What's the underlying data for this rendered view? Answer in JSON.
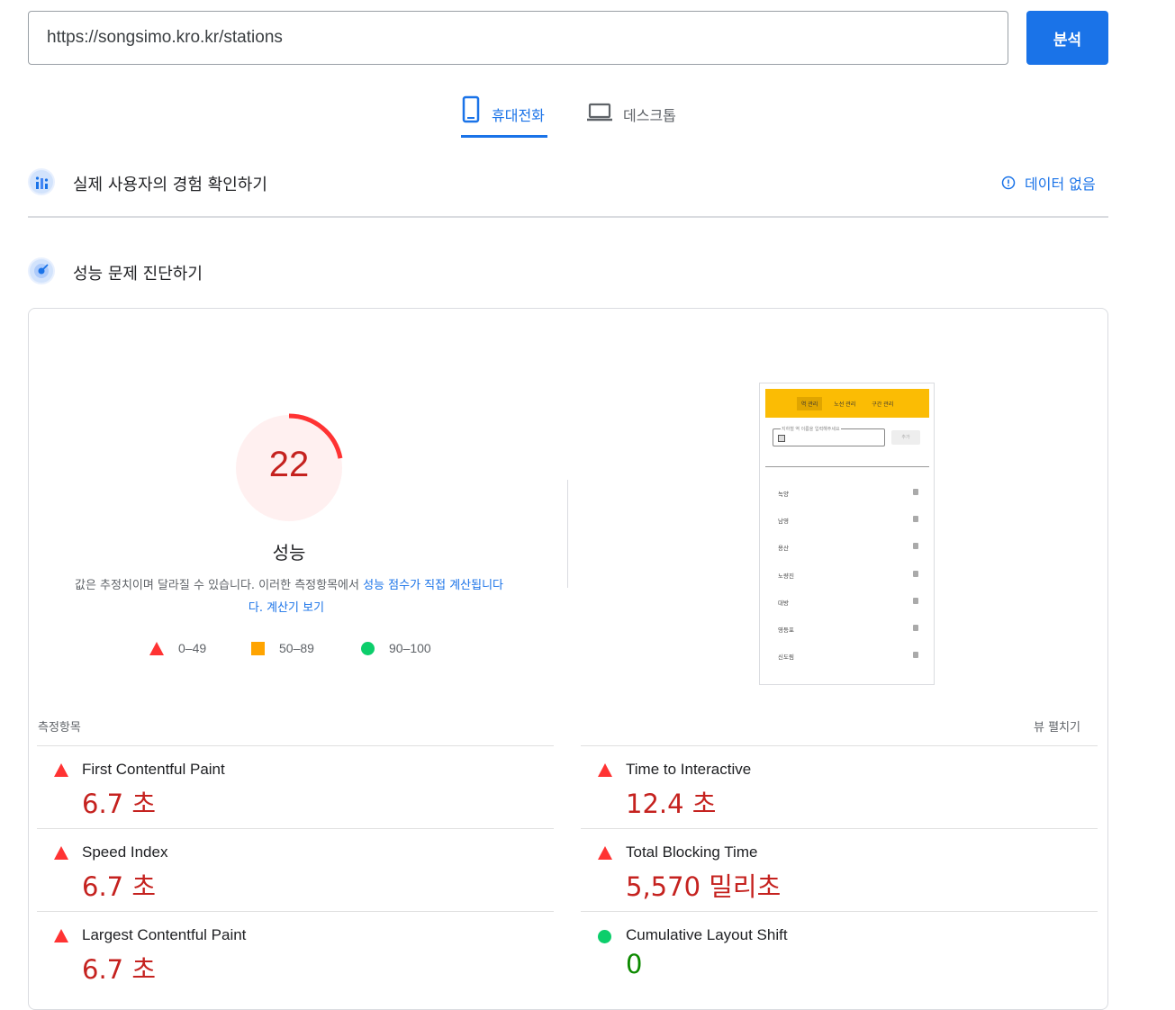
{
  "url_bar": {
    "value": "https://songsimo.kro.kr/stations"
  },
  "analyze_button": {
    "label": "분석"
  },
  "device_tabs": [
    {
      "label": "휴대전화",
      "icon": "smartphone-icon",
      "selected": true
    },
    {
      "label": "데스크톱",
      "icon": "laptop-icon",
      "selected": false
    }
  ],
  "field_data": {
    "title": "실제 사용자의 경험 확인하기",
    "status": "데이터 없음"
  },
  "lab_data": {
    "title": "성능 문제 진단하기"
  },
  "score": {
    "value": "22",
    "fraction": 0.22,
    "label": "성능",
    "desc_prefix": "값은 추정치이며 달라질 수 있습니다. 이러한 측정항목에서 ",
    "desc_link": "성능 점수가 직접 계산됩니다",
    "desc_link2": ". 계산기 보기",
    "colors": {
      "fail": "#ff3333",
      "fail_bg": "#fff0f0",
      "fail_text": "#c5221f"
    }
  },
  "legend": [
    {
      "range": "0–49",
      "shape": "triangle",
      "color": "#ff3333"
    },
    {
      "range": "50–89",
      "shape": "square",
      "color": "#ffa400"
    },
    {
      "range": "90–100",
      "shape": "circle",
      "color": "#0cce6b"
    }
  ],
  "screenshot": {
    "nav": [
      "역 관리",
      "노선 관리",
      "구간 관리"
    ],
    "input_placeholder": "지하철 역 이름을 입력해주세요",
    "add_button": "추가",
    "stations": [
      "녹양",
      "남영",
      "용산",
      "노량진",
      "대방",
      "영등포",
      "신도림"
    ]
  },
  "metrics_section": {
    "title": "측정항목",
    "expand_label": "뷰 펼치기"
  },
  "metrics": [
    {
      "name": "First Contentful Paint",
      "value": "6.7 초",
      "status": "fail"
    },
    {
      "name": "Time to Interactive",
      "value": "12.4 초",
      "status": "fail"
    },
    {
      "name": "Speed Index",
      "value": "6.7 초",
      "status": "fail"
    },
    {
      "name": "Total Blocking Time",
      "value": "5,570 밀리초",
      "status": "fail"
    },
    {
      "name": "Largest Contentful Paint",
      "value": "6.7 초",
      "status": "fail"
    },
    {
      "name": "Cumulative Layout Shift",
      "value": "0",
      "status": "pass"
    }
  ]
}
